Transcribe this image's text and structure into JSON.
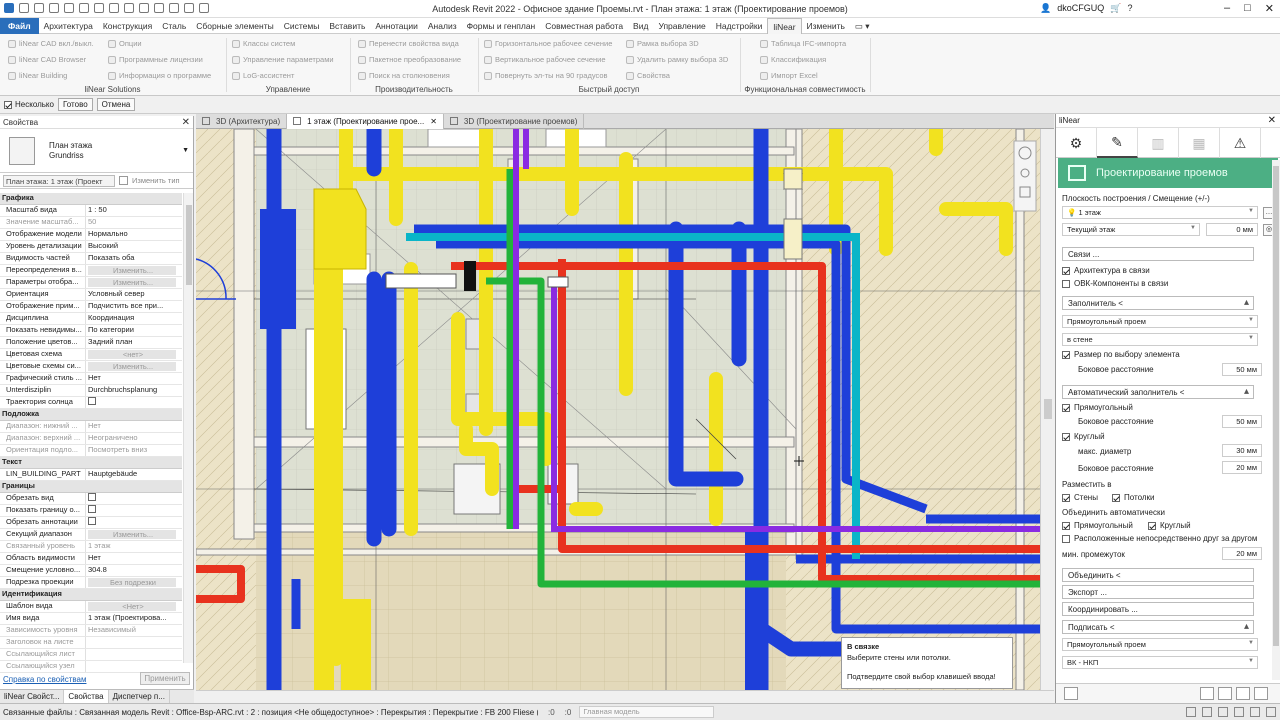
{
  "titlebar": {
    "title": "Autodesk Revit 2022 - Офисное здание Проемы.rvt - План этажа: 1 этаж (Проектирование проемов)",
    "user": "dkoCFGUQ"
  },
  "menu": [
    "Файл",
    "Архитектура",
    "Конструкция",
    "Сталь",
    "Сборные элементы",
    "Системы",
    "Вставить",
    "Аннотации",
    "Анализ",
    "Формы и генплан",
    "Совместная работа",
    "Вид",
    "Управление",
    "Надстройки",
    "liNear",
    "Изменить"
  ],
  "ribbon": {
    "liNearSolutions": {
      "label": "liNear Solutions",
      "items": [
        "liNear CAD вкл./выкл.",
        "liNear CAD Browser",
        "liNear Building",
        "Опции",
        "Программные лицензии",
        "Информация о программе"
      ]
    },
    "management": {
      "label": "Управление",
      "items": [
        "Классы систем",
        "Управление параметрами",
        "LoG-ассистент"
      ]
    },
    "productivity": {
      "label": "Производительность",
      "items": [
        "Перенести свойства вида",
        "Пакетное преобразование",
        "Поиск на столкновения"
      ]
    },
    "quick": {
      "label": "Быстрый доступ",
      "items": [
        "Горизонтальное рабочее сечение",
        "Вертикальное рабочее сечение",
        "Повернуть эл-ты на 90 градусов",
        "Рамка выбора 3D",
        "Удалить рамку выбора 3D",
        "Свойства"
      ]
    },
    "compat": {
      "label": "Функциональная совместимость",
      "items": [
        "Таблица IFC-импорта",
        "Классификация",
        "Импорт Excel"
      ]
    }
  },
  "options": {
    "multi": "Несколько",
    "done": "Готово",
    "cancel": "Отмена"
  },
  "properties": {
    "title": "Свойства",
    "type1": "План этажа",
    "type2": "Grundriss",
    "instance": "План этажа: 1 этаж (Проект",
    "edit_type": "Изменить тип",
    "help": "Справка по свойствам",
    "apply": "Применить",
    "rows": [
      {
        "s": "Графика"
      },
      {
        "k": "Масштаб вида",
        "v": "1 : 50"
      },
      {
        "k": "Значение масштаб...",
        "v": "50",
        "g": true
      },
      {
        "k": "Отображение модели",
        "v": "Нормально"
      },
      {
        "k": "Уровень детализации",
        "v": "Высокий"
      },
      {
        "k": "Видимость частей",
        "v": "Показать оба"
      },
      {
        "k": "Переопределения в...",
        "v": "Изменить...",
        "b": true
      },
      {
        "k": "Параметры отобра...",
        "v": "Изменить...",
        "b": true
      },
      {
        "k": "Ориентация",
        "v": "Условный север"
      },
      {
        "k": "Отображение прим...",
        "v": "Подчистить все при..."
      },
      {
        "k": "Дисциплина",
        "v": "Координация"
      },
      {
        "k": "Показать невидимы...",
        "v": "По категории"
      },
      {
        "k": "Положение цветов...",
        "v": "Задний план"
      },
      {
        "k": "Цветовая схема",
        "v": "<нет>",
        "b": true
      },
      {
        "k": "Цветовые схемы си...",
        "v": "Изменить...",
        "b": true
      },
      {
        "k": "Графический стиль ...",
        "v": "Нет"
      },
      {
        "k": "Unterdisziplin",
        "v": "Durchbruchsplanung"
      },
      {
        "k": "Траектория солнца",
        "v": "",
        "c": true
      },
      {
        "s": "Подложка"
      },
      {
        "k": "Диапазон: нижний ...",
        "v": "Нет",
        "g": true
      },
      {
        "k": "Диапазон: верхний ...",
        "v": "Неограничено",
        "g": true
      },
      {
        "k": "Ориентация подло...",
        "v": "Посмотреть вниз",
        "g": true
      },
      {
        "s": "Текст"
      },
      {
        "k": "LIN_BUILDING_PART",
        "v": "Hauptgebäude"
      },
      {
        "s": "Границы"
      },
      {
        "k": "Обрезать вид",
        "v": "",
        "c": true
      },
      {
        "k": "Показать границу о...",
        "v": "",
        "c": true
      },
      {
        "k": "Обрезать аннотации",
        "v": "",
        "c": true
      },
      {
        "k": "Секущий диапазон",
        "v": "Изменить...",
        "b": true
      },
      {
        "k": "Связанный уровень",
        "v": "1 этаж",
        "g": true
      },
      {
        "k": "Область видимости",
        "v": "Нет"
      },
      {
        "k": "Смещение условно...",
        "v": "304.8"
      },
      {
        "k": "Подрезка проекции",
        "v": "Без подрезки",
        "b": true
      },
      {
        "s": "Идентификация"
      },
      {
        "k": "Шаблон вида",
        "v": "<Нет>",
        "b": true
      },
      {
        "k": "Имя вида",
        "v": "1 этаж (Проектирова..."
      },
      {
        "k": "Зависимость уровня",
        "v": "Независимый",
        "g": true
      },
      {
        "k": "Заголовок на листе",
        "v": "",
        "g": true
      },
      {
        "k": "Ссылающийся лист",
        "v": "",
        "g": true
      },
      {
        "k": "Ссылающийся узел",
        "v": "",
        "g": true
      }
    ],
    "tabs": [
      "liNear Свойст...",
      "Свойства",
      "Диспетчер п..."
    ]
  },
  "doctabs": [
    "3D (Архитектура)",
    "1 этаж (Проектирование прое...",
    "3D (Проектирование проемов)"
  ],
  "tooltip": {
    "title": "В связке",
    "line1": "Выберите стены или потолки.",
    "line2": "Подтвердите свой выбор клавишей ввода!"
  },
  "linear": {
    "title": "liNear",
    "banner": "Проектирование проемов",
    "plane_label": "Плоскость построения / Смещение (+/-)",
    "level": "1 этаж",
    "current_floor": "Текущий этаж",
    "offset": "0 мм",
    "links": "Связи ...",
    "arch": "Архитектура в связи",
    "ovk": "ОВК-Компоненты в связи",
    "filler": "Заполнитель <",
    "rect_open": "Прямоугольный проем",
    "in_wall": "в стене",
    "size_sel": "Размер по выбору элемента",
    "side_dist": "Боковое расстояние",
    "v50": "50 мм",
    "auto": "Автоматический заполнитель <",
    "rect": "Прямоугольный",
    "round": "Круглый",
    "max_d": "макс. диаметр",
    "v30": "30 мм",
    "v20": "20 мм",
    "place_in": "Разместить в",
    "walls": "Стены",
    "ceilings": "Потолки",
    "merge": "Объединить автоматически",
    "adjacent": "Расположенные непосредственно друг за другом",
    "min_gap": "мин. промежуток",
    "union": "Объединить <",
    "export": "Экспорт ...",
    "coordinate": "Координировать ...",
    "sign": "Подписать <",
    "sign_sel": "Прямоугольный проем",
    "vk": "ВК - НКП"
  },
  "status": {
    "text": "Связанные файлы : Связанная модель Revit : Office-Bsp-ARC.rvt : 2 : позиция <Не общедоступное> : Перекрытия : Перекрытие : FB 200 Fliese (",
    "zero1": ":0",
    "zero2": ":0",
    "model": "Главная модель"
  }
}
